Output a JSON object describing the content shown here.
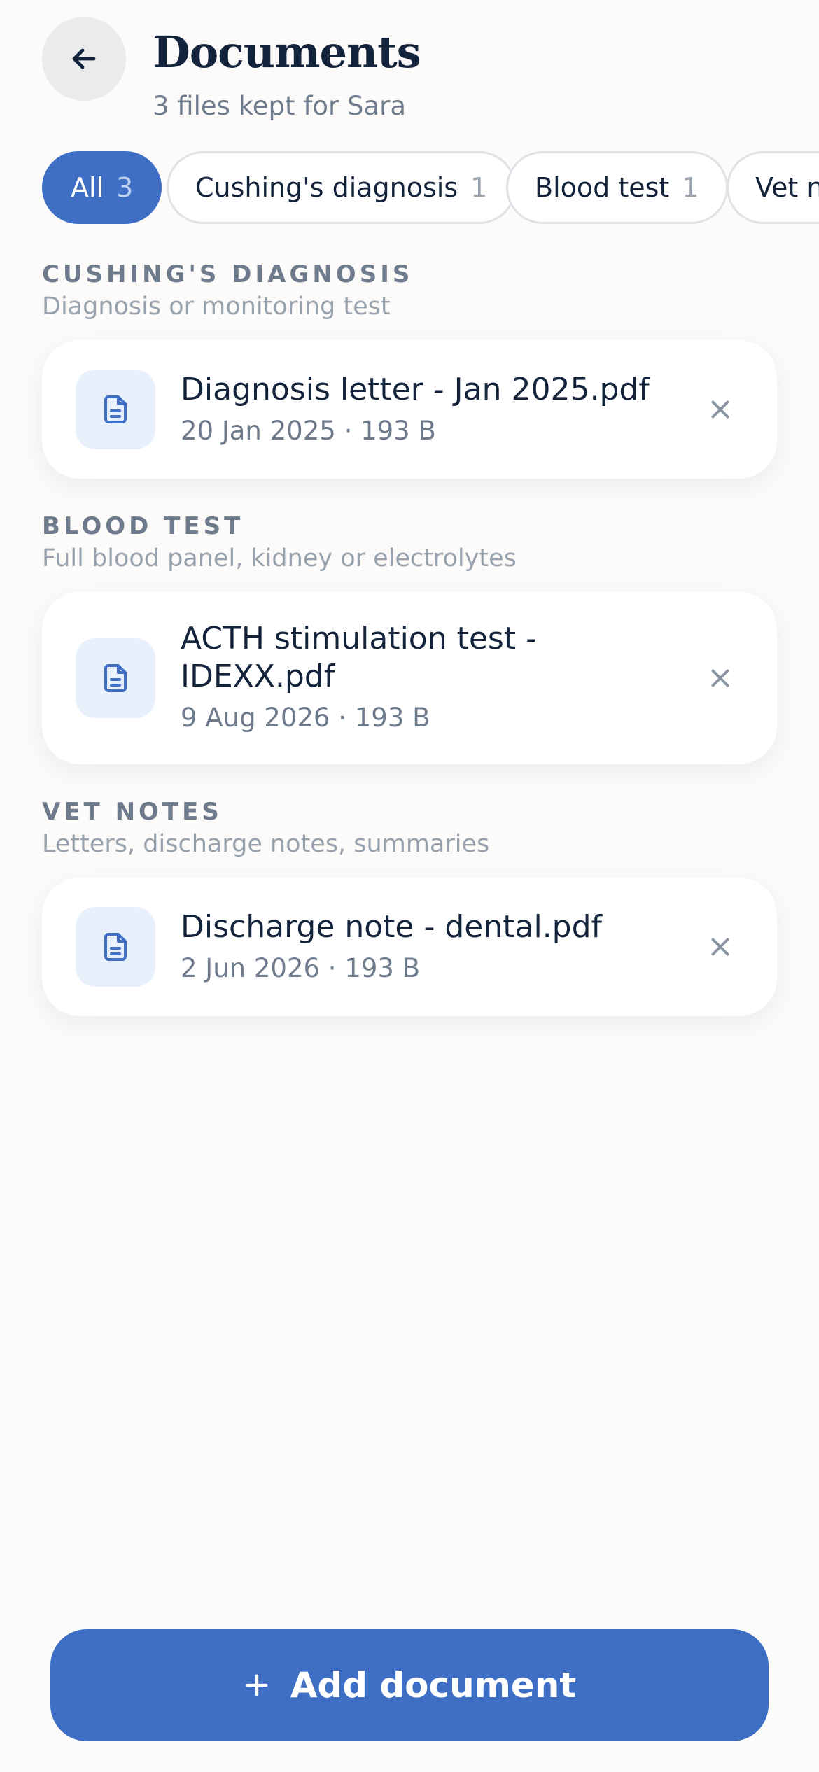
{
  "header": {
    "title": "Documents",
    "subtitle": "3 files kept for Sara",
    "back_icon": "arrow-left-icon"
  },
  "filters": [
    {
      "label": "All",
      "count": "3",
      "active": true
    },
    {
      "label": "Cushing's diagnosis",
      "count": "1",
      "active": false
    },
    {
      "label": "Blood test",
      "count": "1",
      "active": false
    },
    {
      "label": "Vet no",
      "count": "",
      "active": false
    }
  ],
  "sections": [
    {
      "title": "CUSHING'S DIAGNOSIS",
      "description": "Diagnosis or monitoring test",
      "files": [
        {
          "name": "Diagnosis letter - Jan 2025.pdf",
          "meta": "20 Jan 2025 · 193 B"
        }
      ]
    },
    {
      "title": "BLOOD TEST",
      "description": "Full blood panel, kidney or electrolytes",
      "files": [
        {
          "name": "ACTH stimulation test - IDEXX.pdf",
          "meta": "9 Aug 2026 · 193 B"
        }
      ]
    },
    {
      "title": "VET NOTES",
      "description": "Letters, discharge notes, summaries",
      "files": [
        {
          "name": "Discharge note - dental.pdf",
          "meta": "2 Jun 2026 · 193 B"
        }
      ]
    }
  ],
  "add_button": {
    "label": "Add document",
    "icon": "plus-icon"
  },
  "colors": {
    "accent": "#3f6fc5",
    "background": "#fcfbf9",
    "file_icon_bg": "#e8f0fc"
  }
}
